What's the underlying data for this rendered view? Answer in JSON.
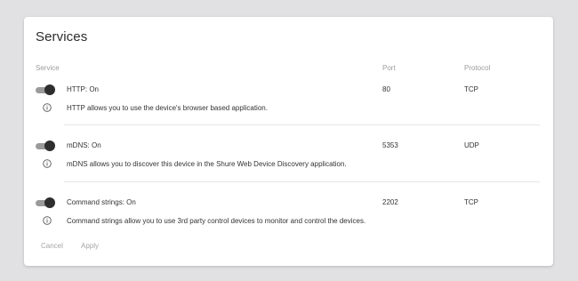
{
  "title": "Services",
  "columns": {
    "service": "Service",
    "port": "Port",
    "protocol": "Protocol"
  },
  "services": [
    {
      "name": "HTTP: On",
      "enabled": true,
      "port": "80",
      "protocol": "TCP",
      "description": "HTTP allows you to use the device's browser based application."
    },
    {
      "name": "mDNS: On",
      "enabled": true,
      "port": "5353",
      "protocol": "UDP",
      "description": "mDNS allows you to discover this device in the Shure Web Device Discovery application."
    },
    {
      "name": "Command strings: On",
      "enabled": true,
      "port": "2202",
      "protocol": "TCP",
      "description": "Command strings allow you to use 3rd party control devices to monitor and control the devices."
    }
  ],
  "actions": {
    "cancel": "Cancel",
    "apply": "Apply"
  },
  "icons": {
    "toggle": "toggle-switch-icon",
    "info": "info-icon"
  },
  "colors": {
    "background": "#e1e1e3",
    "card": "#ffffff",
    "toggle_track": "#9a9a9a",
    "toggle_knob": "#2e2e2e",
    "muted_text": "#9b9b9b"
  }
}
